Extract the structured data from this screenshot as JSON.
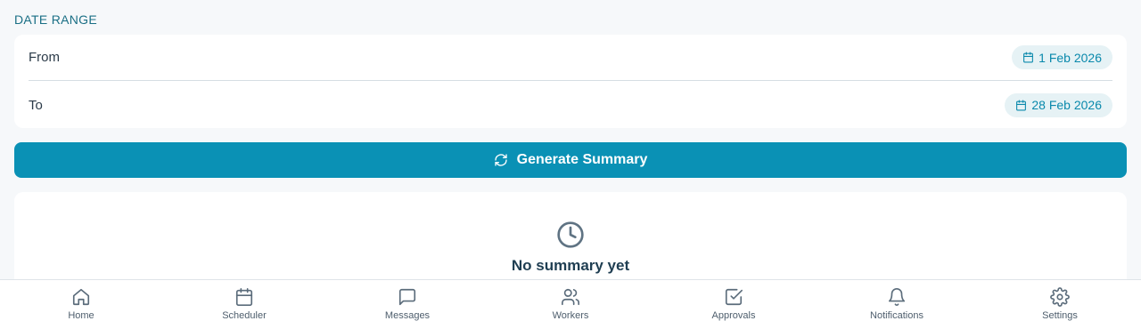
{
  "section": {
    "label": "DATE RANGE"
  },
  "range": {
    "from_label": "From",
    "from_value": "1 Feb 2026",
    "to_label": "To",
    "to_value": "28 Feb 2026"
  },
  "actions": {
    "generate_label": "Generate Summary"
  },
  "summary": {
    "empty_title": "No summary yet"
  },
  "nav": {
    "items": [
      {
        "label": "Home",
        "icon": "home-icon"
      },
      {
        "label": "Scheduler",
        "icon": "calendar-icon"
      },
      {
        "label": "Messages",
        "icon": "message-icon"
      },
      {
        "label": "Workers",
        "icon": "users-icon"
      },
      {
        "label": "Approvals",
        "icon": "check-square-icon"
      },
      {
        "label": "Notifications",
        "icon": "bell-icon"
      },
      {
        "label": "Settings",
        "icon": "gear-icon"
      }
    ]
  },
  "colors": {
    "accent": "#0a91b5",
    "pill_bg": "#e6f2f5",
    "pill_text": "#0a89ac",
    "section_label": "#1a6f85"
  }
}
